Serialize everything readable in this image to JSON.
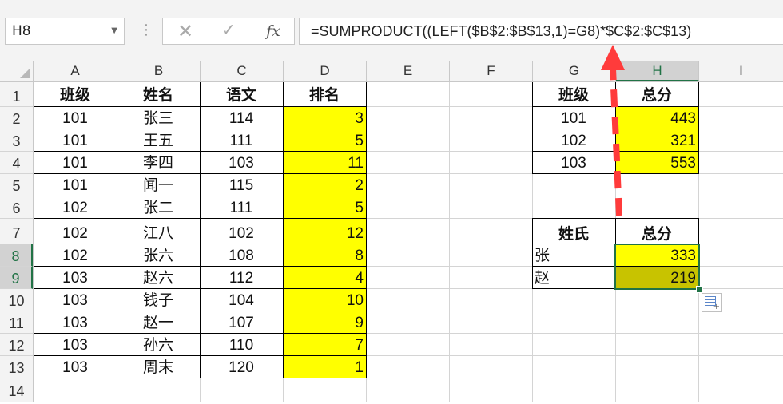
{
  "name_box": "H8",
  "formula": "=SUMPRODUCT((LEFT($B$2:$B$13,1)=G8)*$C$2:$C$13)",
  "formula_buttons": {
    "cancel": "✕",
    "enter": "✓",
    "fx": "fx"
  },
  "columns": [
    "A",
    "B",
    "C",
    "D",
    "E",
    "F",
    "G",
    "H",
    "I"
  ],
  "rows": [
    "1",
    "2",
    "3",
    "4",
    "5",
    "6",
    "7",
    "8",
    "9",
    "10",
    "11",
    "12",
    "13",
    "14"
  ],
  "table1": {
    "headers": [
      "班级",
      "姓名",
      "语文",
      "排名"
    ],
    "rows": [
      [
        "101",
        "张三",
        "114",
        "3"
      ],
      [
        "101",
        "王五",
        "111",
        "5"
      ],
      [
        "101",
        "李四",
        "103",
        "11"
      ],
      [
        "101",
        "闻一",
        "115",
        "2"
      ],
      [
        "102",
        "张二",
        "111",
        "5"
      ],
      [
        "102",
        "江八",
        "102",
        "12"
      ],
      [
        "102",
        "张六",
        "108",
        "8"
      ],
      [
        "103",
        "赵六",
        "112",
        "4"
      ],
      [
        "103",
        "钱子",
        "104",
        "10"
      ],
      [
        "103",
        "赵一",
        "107",
        "9"
      ],
      [
        "103",
        "孙六",
        "110",
        "7"
      ],
      [
        "103",
        "周末",
        "120",
        "1"
      ]
    ]
  },
  "table2": {
    "headers": [
      "班级",
      "总分"
    ],
    "rows": [
      [
        "101",
        "443"
      ],
      [
        "102",
        "321"
      ],
      [
        "103",
        "553"
      ]
    ]
  },
  "table3": {
    "headers": [
      "姓氏",
      "总分"
    ],
    "rows": [
      [
        "张",
        "333"
      ],
      [
        "赵",
        "219"
      ]
    ]
  },
  "colors": {
    "highlight": "#ffff00",
    "selected_fill": "#c8c300",
    "selection_border": "#217346",
    "arrow": "#ff3b3b"
  },
  "active_cell": "H8"
}
